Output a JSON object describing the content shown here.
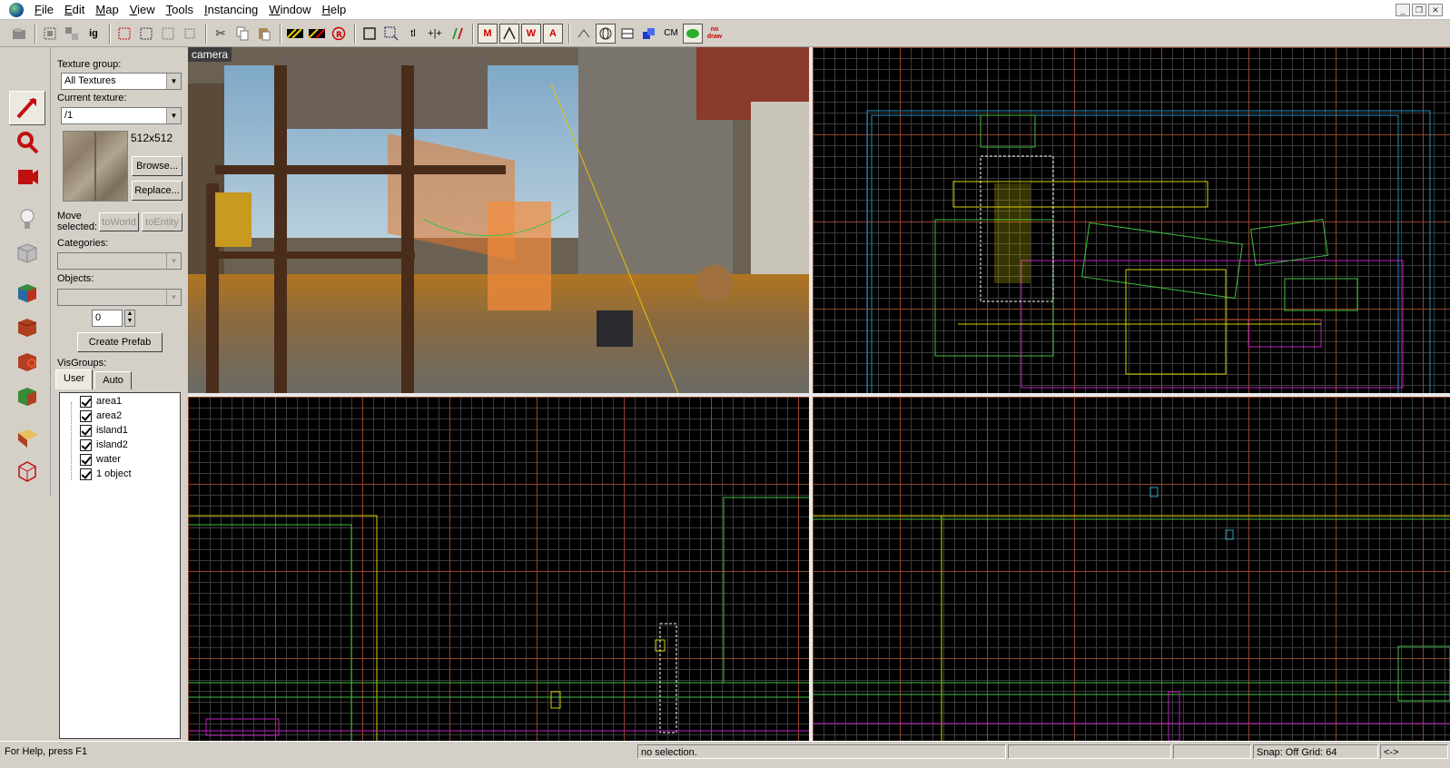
{
  "menubar": {
    "items": [
      "File",
      "Edit",
      "Map",
      "View",
      "Tools",
      "Instancing",
      "Window",
      "Help"
    ]
  },
  "toolbar": {
    "groups": [
      [
        "open-icon"
      ],
      [
        "group-icon",
        "ungroup-icon",
        "ig"
      ],
      [
        "hide-icon",
        "show-icon",
        "carve-icon",
        "hollow-icon"
      ],
      [
        "cut-icon",
        "copy-icon",
        "paste-icon"
      ],
      [
        "toggle-grid-icon",
        "toggle-3d-grid-icon",
        "r-icon"
      ],
      [
        "select-icon",
        "texture-lock-icon",
        "tl",
        "vertex-icon",
        "cordon-icon"
      ],
      [
        "models-icon",
        "decals-icon",
        "wireframe-icon",
        "overlays-icon"
      ],
      [
        "helpers-icon",
        "sphere-icon",
        "flat-icon",
        "blue-icon",
        "CM",
        "leaf-icon",
        "nodraw-icon"
      ]
    ]
  },
  "tools": [
    "selection-tool-icon",
    "magnify-tool-icon",
    "camera-tool-icon",
    "entity-tool-icon",
    "block-tool-icon",
    "texture-app-icon",
    "apply-texture-icon",
    "decal-tool-icon",
    "overlay-tool-icon",
    "clip-tool-icon",
    "vertex-tool-icon"
  ],
  "panel": {
    "texture_group_label": "Texture group:",
    "texture_group_value": "All Textures",
    "current_texture_label": "Current texture:",
    "current_texture_value": "/1",
    "texture_size": "512x512",
    "browse_label": "Browse...",
    "replace_label": "Replace...",
    "move_selected_label_1": "Move",
    "move_selected_label_2": "selected:",
    "to_world_label": "toWorld",
    "to_entity_label": "toEntity",
    "categories_label": "Categories:",
    "objects_label": "Objects:",
    "prefab_count": "0",
    "create_prefab_label": "Create Prefab",
    "visgroups_label": "VisGroups:",
    "tabs": [
      "User",
      "Auto"
    ],
    "visgroups": [
      "area1",
      "area2",
      "island1",
      "island2",
      "water",
      "1 object"
    ]
  },
  "viewports": {
    "camera_label": "camera"
  },
  "status": {
    "help": "For Help, press F1",
    "selection": "no selection.",
    "snap": "Snap: Off Grid: 64",
    "arrows": "<->"
  }
}
